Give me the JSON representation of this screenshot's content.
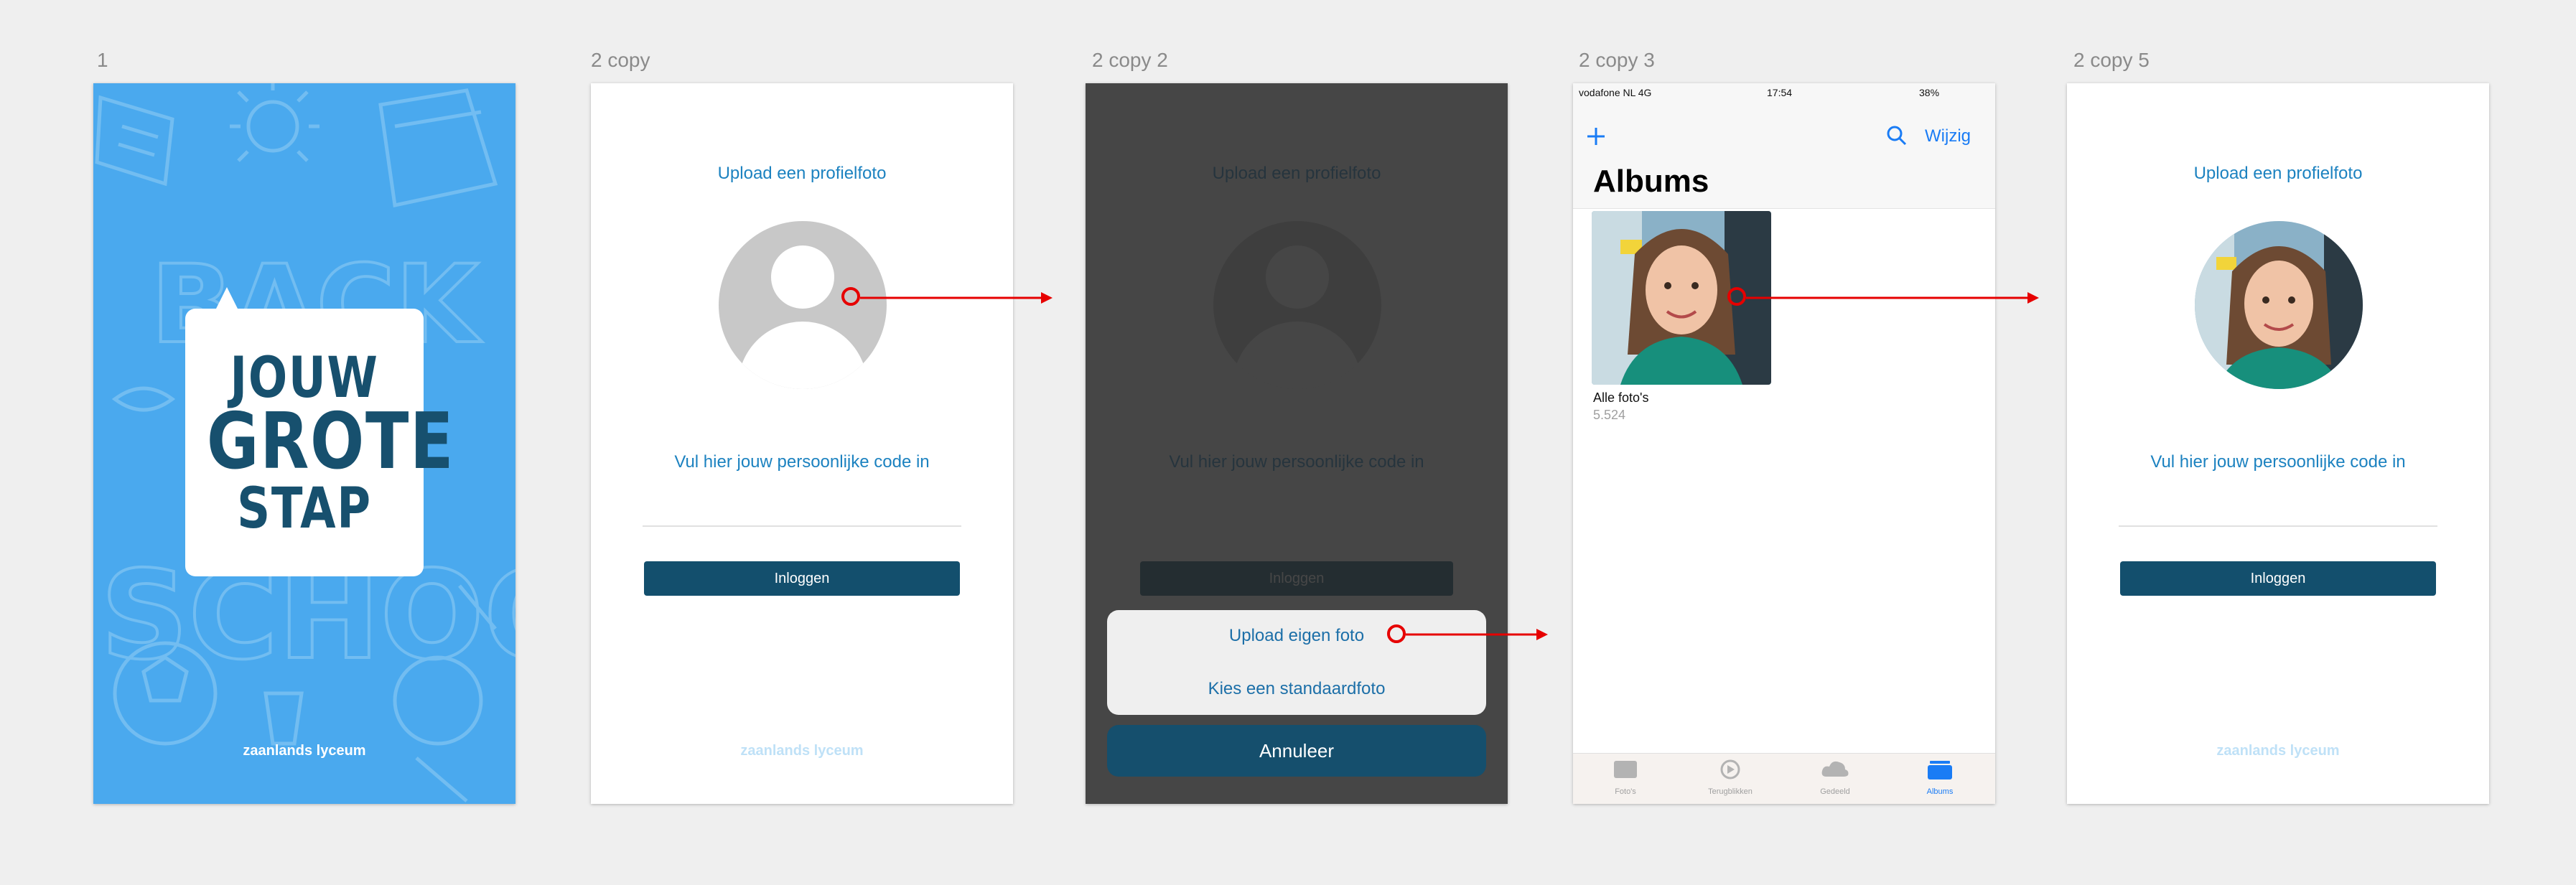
{
  "artboards": [
    {
      "label": "1"
    },
    {
      "label": "2 copy"
    },
    {
      "label": "2 copy 2"
    },
    {
      "label": "2 copy 3"
    },
    {
      "label": "2 copy 5"
    }
  ],
  "splash": {
    "title_line1": "JOUW",
    "title_line2": "GROTE",
    "title_line3": "STAP",
    "footer": "zaanlands lyceum",
    "background_color": "#4aa9ee"
  },
  "login": {
    "upload_link": "Upload een profielfoto",
    "code_label": "Vul hier jouw persoonlijke code in",
    "login_button": "Inloggen",
    "footer": "zaanlands lyceum"
  },
  "action_sheet": {
    "upload_own": "Upload eigen foto",
    "choose_default": "Kies een standaardfoto",
    "cancel": "Annuleer"
  },
  "photos": {
    "status_carrier": "vodafone NL  4G",
    "status_time": "17:54",
    "status_battery": "38%",
    "add_icon": "plus-icon",
    "edit_label": "Wijzig",
    "title": "Albums",
    "album_name": "Alle foto's",
    "album_count": "5.524",
    "tabs": [
      "Foto's",
      "Terugblikken",
      "Gedeeld",
      "Albums"
    ]
  },
  "colors": {
    "accent_link": "#1c82c0",
    "button_dark": "#134f6d",
    "prototype_link": "#e60000",
    "ios_blue": "#1a7cf5"
  }
}
